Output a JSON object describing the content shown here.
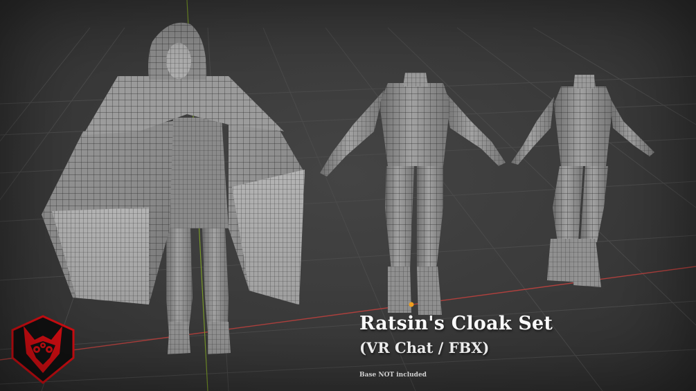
{
  "title": "Ratsin's Cloak Set",
  "subtitle": "(VR Chat / FBX)",
  "note": "Base NOT included",
  "colors": {
    "background": "#3b3b3b",
    "grid_line": "#4a4a4a",
    "x_axis": "#b0413e",
    "y_axis": "#7a9a2a",
    "mesh_fill": "#8c8c8c",
    "wire": "#2a2a2a",
    "logo_red": "#d10d12",
    "text": "#ffffff"
  },
  "icons": [
    "fox-mask-logo-icon",
    "origin-point-icon"
  ]
}
